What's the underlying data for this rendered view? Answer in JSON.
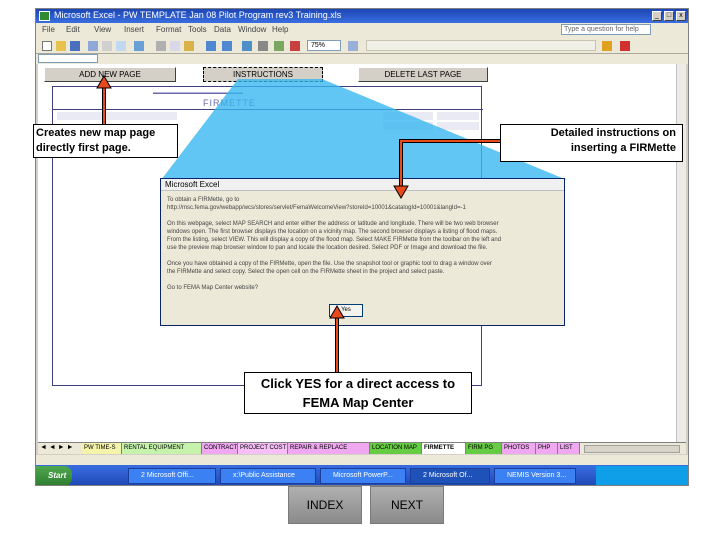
{
  "window": {
    "title": "Microsoft Excel - PW TEMPLATE Jan 08 Pilot Program rev3 Training.xls",
    "help_placeholder": "Type a question for help"
  },
  "menu": [
    "File",
    "Edit",
    "View",
    "Insert",
    "Format",
    "Tools",
    "Data",
    "Window",
    "Help"
  ],
  "toolbar": {
    "zoom": "75%"
  },
  "sheet_buttons": {
    "add": "ADD NEW PAGE",
    "instructions": "INSTRUCTIONS",
    "delete": "DELETE LAST PAGE"
  },
  "form": {
    "title": "FIRMETTE"
  },
  "sheet_tabs": [
    "PW TIME-S",
    "RENTAL EQUIPMENT",
    "CONTRACT",
    "PROJECT COST",
    "REPAIR & REPLACE",
    "LOCATION MAP",
    "FIRMETTE",
    "FIRM PG",
    "PHOTOS",
    "PHP",
    "LIST"
  ],
  "taskbar": {
    "start": "Start",
    "tasks": [
      "2 Microsoft Offi...",
      "x:\\Public Assistance",
      "Microsoft PowerP...",
      "2 Microsoft Of...",
      "NEMIS Version 3..."
    ]
  },
  "dialog": {
    "title": "Microsoft Excel",
    "lines": [
      "To obtain a FIRMette, go to",
      "http://msc.fema.gov/webapp/wcs/stores/servlet/FemaWelcomeView?storeId=10001&catalogId=10001&langId=-1",
      "On this webpage, select MAP SEARCH and enter either the address or latitude and longitude. There will be two web browser",
      "windows open. The first browser displays the location on a vicinity map. The second browser displays a listing of flood maps.",
      "From the listing, select VIEW. This will display a copy of the flood map. Select MAKE FIRMette from the toolbar on the left and",
      "use the preview map browser window to pan and locate the location desired. Select PDF or Image and download the file.",
      "Once you have obtained a copy of the FIRMette, open the file. Use the snapshot tool or graphic tool to drag a window over",
      "the FIRMette and select copy. Select the open cell on the FIRMette sheet in the project and select paste.",
      "Go to FEMA Map Center website?"
    ],
    "yes_label": "Yes"
  },
  "annotations": {
    "left": "Creates new map page directly first page.",
    "right": "Detailed instructions on inserting a FIRMette",
    "bottom": "Click YES for a direct access to FEMA Map Center"
  },
  "nav": {
    "index": "INDEX",
    "next": "NEXT"
  },
  "colors": {
    "annotation_line": "#e8491d",
    "beam": "#35b6f0",
    "titlebar": "#1c46b4"
  }
}
